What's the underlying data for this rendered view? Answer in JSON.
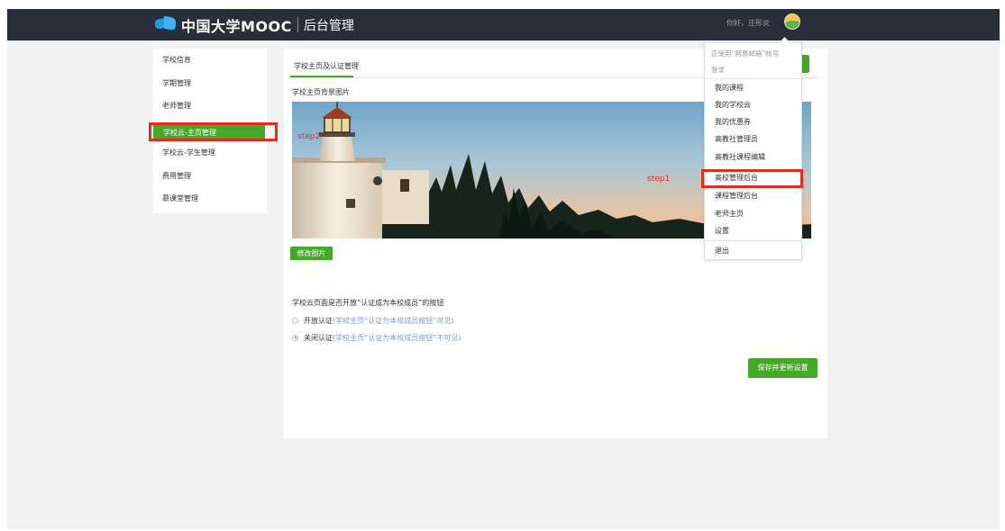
{
  "header": {
    "brand": "中国大学MOOC",
    "subtitle": "后台管理",
    "greeting": "你好，庄彤炎"
  },
  "sidebar": {
    "items": [
      {
        "label": "学校信息"
      },
      {
        "label": "学期管理"
      },
      {
        "label": "老师管理"
      },
      {
        "label": "学校云-主页管理",
        "active": true
      },
      {
        "label": "学校云-学生管理"
      },
      {
        "label": "费用管理"
      },
      {
        "label": "慕课堂管理"
      }
    ]
  },
  "main": {
    "tab": "学校主页及认证管理",
    "bg_label": "学校主页背景图片",
    "edit_button": "修改图片",
    "question": "学校云页面是否开放“认证成为本校成员”的按钮",
    "options": [
      {
        "label": "开放认证",
        "hint": "(学校主页“认证为本校成员按钮”可见)",
        "selected": false
      },
      {
        "label": "关闭认证",
        "hint": "(学校主页“认证为本校成员按钮”不可见)",
        "selected": true
      }
    ],
    "save_button": "保存并更新设置"
  },
  "dropdown": {
    "note_line1": "正使用“网易邮箱”帐号",
    "note_line2": "登录",
    "items": [
      {
        "label": "我的课程"
      },
      {
        "label": "我的学校云"
      },
      {
        "label": "我的优惠券"
      },
      {
        "label": "高教社管理员"
      },
      {
        "label": "高教社课程编辑"
      },
      {
        "label": "高校管理后台",
        "highlighted": true
      },
      {
        "label": "课程管理后台"
      },
      {
        "label": "老师主页"
      },
      {
        "label": "设置"
      }
    ],
    "logout": "退出"
  },
  "annotations": {
    "step1": "step1",
    "step2": "step2"
  },
  "colors": {
    "header_bg": "#2a2e39",
    "accent_green": "#46a829",
    "highlight_red": "#e52b1d",
    "page_bg": "#f2f2f2"
  }
}
